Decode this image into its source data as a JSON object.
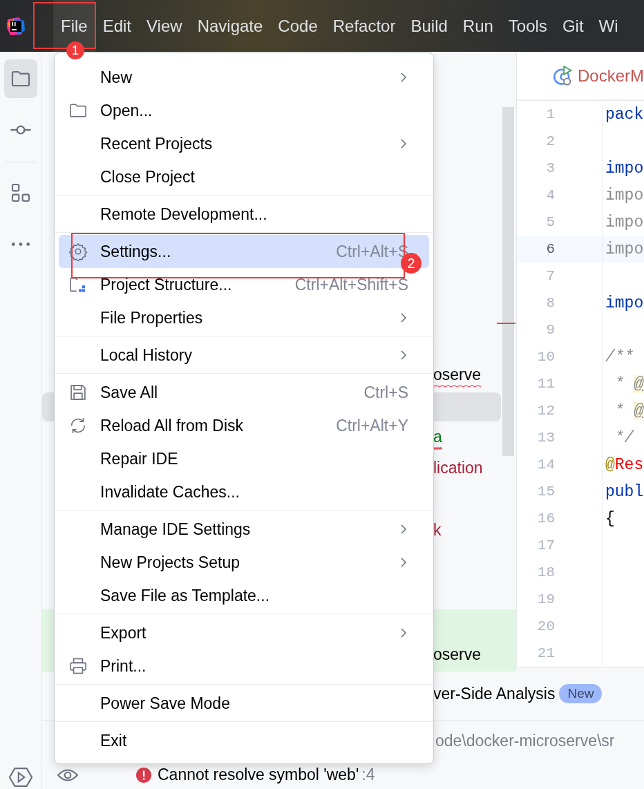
{
  "menu_bar": {
    "items": [
      {
        "label": "File",
        "selected": true
      },
      {
        "label": "Edit",
        "selected": false
      },
      {
        "label": "View",
        "selected": false
      },
      {
        "label": "Navigate",
        "selected": false
      },
      {
        "label": "Code",
        "selected": false
      },
      {
        "label": "Refactor",
        "selected": false
      },
      {
        "label": "Build",
        "selected": false
      },
      {
        "label": "Run",
        "selected": false
      },
      {
        "label": "Tools",
        "selected": false
      },
      {
        "label": "Git",
        "selected": false
      },
      {
        "label": "Wi",
        "selected": false
      }
    ]
  },
  "tool_strip": {
    "items": [
      {
        "selected": true
      },
      {
        "selected": false
      },
      {
        "selected": false
      },
      {
        "selected": false
      }
    ]
  },
  "project_tree": {
    "rows": [
      {
        "text": "oserve",
        "color": "#000000",
        "error": true,
        "selected": false,
        "highlighted": false
      },
      {
        "selected": true,
        "highlighted": false
      },
      {
        "text": "a",
        "color": "#067d17",
        "error": true,
        "selected": false,
        "highlighted": false
      },
      {
        "text": "lication",
        "color": "#a8223a",
        "error": false,
        "selected": false,
        "highlighted": false
      },
      {
        "selected": false,
        "highlighted": false
      },
      {
        "text": "k",
        "color": "#a8223a",
        "error": false,
        "selected": false,
        "highlighted": false
      },
      {
        "selected": false,
        "highlighted": false
      },
      {
        "selected": false,
        "highlighted": false
      },
      {
        "selected": false,
        "highlighted": true
      },
      {
        "text": "oserve",
        "color": "#000000",
        "error": false,
        "selected": false,
        "highlighted": true
      }
    ]
  },
  "editor": {
    "tab": {
      "label": "DockerM"
    },
    "lines": [
      {
        "number": "1",
        "current": false,
        "tokens": [
          {
            "text": "pack",
            "kind": "keyword"
          }
        ]
      },
      {
        "number": "2",
        "current": false
      },
      {
        "number": "3",
        "current": false,
        "tokens": [
          {
            "text": "impo",
            "kind": "keyword"
          }
        ]
      },
      {
        "number": "4",
        "current": false,
        "tokens": [
          {
            "text": "impo",
            "kind": "unused"
          }
        ]
      },
      {
        "number": "5",
        "current": false,
        "tokens": [
          {
            "text": "impo",
            "kind": "unused"
          }
        ]
      },
      {
        "number": "6",
        "current": true,
        "tokens": [
          {
            "text": "impo",
            "kind": "unused"
          }
        ]
      },
      {
        "number": "7",
        "current": false
      },
      {
        "number": "8",
        "current": false,
        "tokens": [
          {
            "text": "impo",
            "kind": "keyword"
          }
        ]
      },
      {
        "number": "9",
        "current": false
      },
      {
        "number": "10",
        "current": false,
        "tokens": [
          {
            "text": "/**",
            "kind": "comment"
          }
        ]
      },
      {
        "number": "11",
        "current": false,
        "tokens": [
          {
            "text": " * ",
            "kind": "comment"
          },
          {
            "text": "@",
            "kind": "doc_tag"
          }
        ]
      },
      {
        "number": "12",
        "current": false,
        "tokens": [
          {
            "text": " * ",
            "kind": "comment"
          },
          {
            "text": "@",
            "kind": "doc_tag"
          }
        ]
      },
      {
        "number": "13",
        "current": false,
        "tokens": [
          {
            "text": " */",
            "kind": "comment"
          }
        ]
      },
      {
        "number": "14",
        "current": false,
        "tokens": [
          {
            "text": "@",
            "kind": "annotation"
          },
          {
            "text": "Res",
            "kind": "error"
          }
        ]
      },
      {
        "number": "15",
        "current": false,
        "tokens": [
          {
            "text": "publ",
            "kind": "keyword"
          }
        ]
      },
      {
        "number": "16",
        "current": false,
        "tokens": [
          {
            "text": "{",
            "kind": "plain"
          }
        ]
      },
      {
        "number": "17",
        "current": false
      },
      {
        "number": "18",
        "current": false
      },
      {
        "number": "19",
        "current": false
      },
      {
        "number": "20",
        "current": false
      },
      {
        "number": "21",
        "current": false
      }
    ]
  },
  "bottom_panel": {
    "analysis": {
      "label": "ver-Side Analysis",
      "badge": "New"
    },
    "path": "ode\\docker-microserve\\sr",
    "problem": {
      "message": "Cannot resolve symbol 'web'",
      "location": ":4"
    }
  },
  "file_menu": {
    "groups": [
      [
        {
          "label": "New",
          "submenu": true,
          "selected": false
        },
        {
          "label": "Open...",
          "submenu": false,
          "selected": false
        },
        {
          "label": "Recent Projects",
          "submenu": true,
          "selected": false
        },
        {
          "label": "Close Project",
          "submenu": false,
          "selected": false
        }
      ],
      [
        {
          "label": "Remote Development...",
          "submenu": false,
          "selected": false
        }
      ],
      [
        {
          "label": "Settings...",
          "shortcut": "Ctrl+Alt+S",
          "submenu": false,
          "selected": true
        },
        {
          "label": "Project Structure...",
          "shortcut": "Ctrl+Alt+Shift+S",
          "submenu": false,
          "selected": false
        },
        {
          "label": "File Properties",
          "submenu": true,
          "selected": false
        }
      ],
      [
        {
          "label": "Local History",
          "submenu": true,
          "selected": false
        }
      ],
      [
        {
          "label": "Save All",
          "shortcut": "Ctrl+S",
          "submenu": false,
          "selected": false
        },
        {
          "label": "Reload All from Disk",
          "shortcut": "Ctrl+Alt+Y",
          "submenu": false,
          "selected": false
        },
        {
          "label": "Repair IDE",
          "submenu": false,
          "selected": false
        },
        {
          "label": "Invalidate Caches...",
          "submenu": false,
          "selected": false
        }
      ],
      [
        {
          "label": "Manage IDE Settings",
          "submenu": true,
          "selected": false
        },
        {
          "label": "New Projects Setup",
          "submenu": true,
          "selected": false
        },
        {
          "label": "Save File as Template...",
          "submenu": false,
          "selected": false
        }
      ],
      [
        {
          "label": "Export",
          "submenu": true,
          "selected": false
        },
        {
          "label": "Print...",
          "submenu": false,
          "selected": false
        }
      ],
      [
        {
          "label": "Power Save Mode",
          "submenu": false,
          "selected": false
        }
      ],
      [
        {
          "label": "Exit",
          "submenu": false,
          "selected": false
        }
      ]
    ]
  },
  "annotations": [
    {
      "label": "1"
    },
    {
      "label": "2"
    }
  ]
}
